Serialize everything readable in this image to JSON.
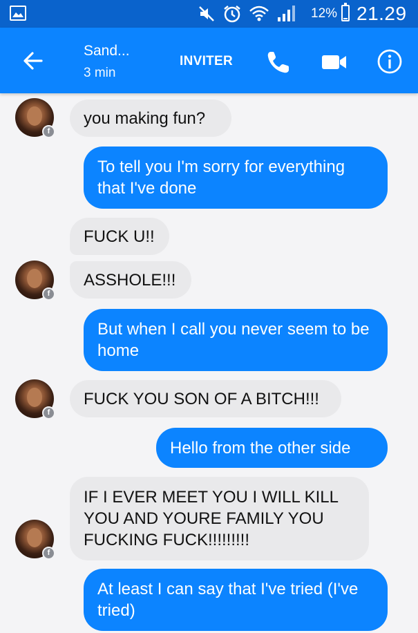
{
  "status_bar": {
    "battery_percent": "12%",
    "battery_level": 0.12,
    "time": "21.29",
    "icons": [
      "gallery-icon",
      "mute-icon",
      "alarm-icon",
      "wifi-icon",
      "signal-icon",
      "battery-icon"
    ]
  },
  "header": {
    "contact_name": "Sand...",
    "contact_status": "3 min",
    "invite_label": "INVITER",
    "icons": [
      "back-arrow-icon",
      "phone-icon",
      "video-camera-icon",
      "info-icon"
    ]
  },
  "messages": [
    {
      "direction": "incoming",
      "text": "you making fun?"
    },
    {
      "direction": "outgoing",
      "text": "To tell you I'm sorry for everything that I've done"
    },
    {
      "direction": "incoming",
      "text": "FUCK U!!"
    },
    {
      "direction": "incoming",
      "text": "ASSHOLE!!!"
    },
    {
      "direction": "outgoing",
      "text": "But when I call you never seem to be home"
    },
    {
      "direction": "incoming",
      "text": "FUCK YOU SON OF A BITCH!!!"
    },
    {
      "direction": "outgoing",
      "text": "Hello from the other side"
    },
    {
      "direction": "incoming",
      "text": "IF I EVER MEET YOU I WILL KILL YOU AND YOURE FAMILY YOU FUCKING FUCK!!!!!!!!!"
    },
    {
      "direction": "outgoing",
      "text": "At least I can say that I've tried (I've tried)"
    }
  ],
  "colors": {
    "status_bar": "#0a63cc",
    "app_bar": "#0c84ff",
    "outgoing_bubble": "#0c84ff",
    "incoming_bubble": "#e9e9eb",
    "background": "#f4f4f6"
  }
}
